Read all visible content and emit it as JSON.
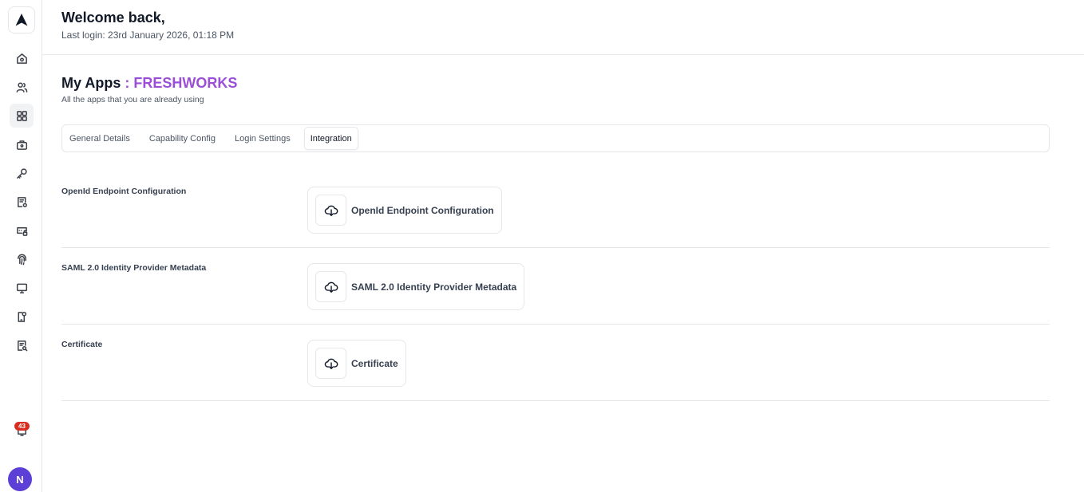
{
  "header": {
    "welcome": "Welcome back,",
    "last_login": "Last login: 23rd January 2026, 01:18 PM"
  },
  "sidebar": {
    "items": [
      {
        "icon": "home-icon"
      },
      {
        "icon": "users-icon"
      },
      {
        "icon": "apps-grid-icon",
        "active": true
      },
      {
        "icon": "briefcase-icon"
      },
      {
        "icon": "key-icon"
      },
      {
        "icon": "document-settings-icon"
      },
      {
        "icon": "password-icon"
      },
      {
        "icon": "fingerprint-icon"
      },
      {
        "icon": "monitor-icon"
      },
      {
        "icon": "device-lock-icon"
      },
      {
        "icon": "document-search-icon"
      }
    ],
    "notifications_count": "43",
    "avatar_initial": "N"
  },
  "page": {
    "title": "My Apps",
    "separator": " : ",
    "app_name": "FRESHWORKS",
    "subtitle": "All the apps that you are already using",
    "accent_color": "#9b4fd6"
  },
  "tabs": [
    {
      "label": "General Details",
      "active": false
    },
    {
      "label": "Capability Config",
      "active": false
    },
    {
      "label": "Login Settings",
      "active": false
    },
    {
      "label": "Integration",
      "active": true
    }
  ],
  "integration": {
    "rows": [
      {
        "label": "OpenId Endpoint Configuration",
        "button": "OpenId Endpoint Configuration",
        "icon": "cloud-download-icon"
      },
      {
        "label": "SAML 2.0 Identity Provider Metadata",
        "button": "SAML 2.0 Identity Provider Metadata",
        "icon": "cloud-download-icon"
      },
      {
        "label": "Certificate",
        "button": "Certificate",
        "icon": "cloud-download-icon"
      }
    ]
  }
}
